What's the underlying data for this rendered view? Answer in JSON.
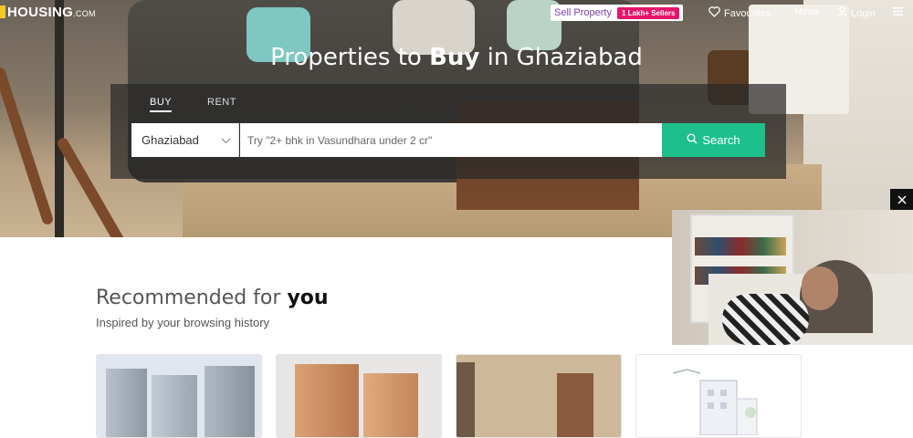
{
  "header": {
    "logo": "HOUSING",
    "logo_suffix": ".COM",
    "sell_property": "Sell Property",
    "sell_badge": "1 Lakh+ Sellers",
    "favourites": "Favourites",
    "news": "News",
    "login": "Login"
  },
  "hero": {
    "title_prefix": "Properties to ",
    "title_bold": "Buy",
    "title_suffix": " in Ghaziabad",
    "tabs": [
      {
        "label": "BUY",
        "active": true
      },
      {
        "label": "RENT",
        "active": false
      }
    ],
    "city": "Ghaziabad",
    "search_placeholder": "Try \"2+ bhk in Vasundhara under 2 cr\"",
    "search_button": "Search"
  },
  "recommended": {
    "title_prefix": "Recommended for ",
    "title_bold": "you",
    "subtitle": "Inspired by your browsing history"
  },
  "colors": {
    "accent": "#1dc08d",
    "badge": "#e8136a",
    "sell_text": "#7b3fb6",
    "logo_mark": "#f3c928"
  }
}
